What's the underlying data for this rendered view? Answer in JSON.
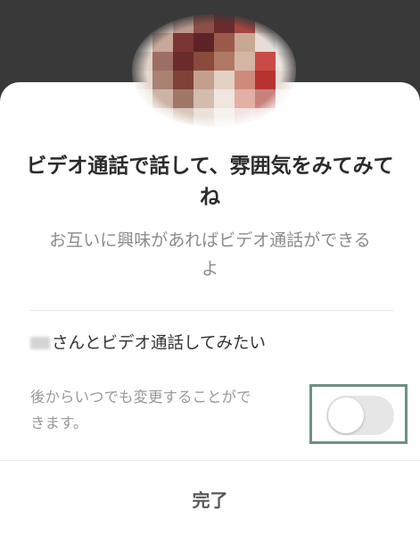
{
  "sheet": {
    "title": "ビデオ通話で話して、雰囲気をみてみてね",
    "subtitle": "お互いに興味があればビデオ通話ができるよ"
  },
  "setting": {
    "label": "さんとビデオ通話してみたい",
    "note": "後からいつでも変更することができます。",
    "toggle_on": false,
    "highlight_color": "#6e8f87"
  },
  "footer": {
    "done_label": "完了"
  },
  "colors": {
    "backdrop": "#393939",
    "toggle_off": "#e6e6e6"
  }
}
